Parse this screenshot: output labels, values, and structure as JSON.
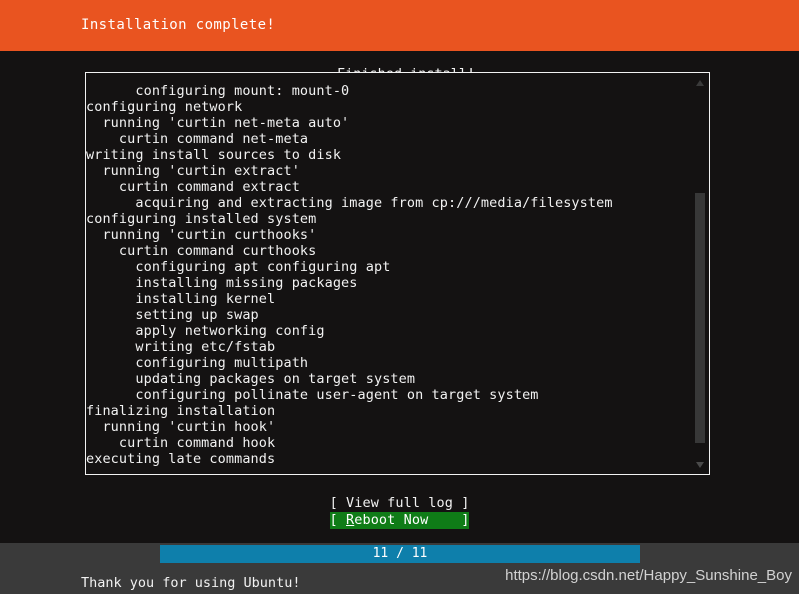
{
  "header": {
    "title": "Installation complete!",
    "background_color": "#e95420",
    "text_color": "#ffffff"
  },
  "log_panel": {
    "legend": "Finished install!",
    "border_color": "#f2f2f2",
    "lines": [
      "      configuring mount: mount-0",
      "configuring network",
      "  running 'curtin net-meta auto'",
      "    curtin command net-meta",
      "writing install sources to disk",
      "  running 'curtin extract'",
      "    curtin command extract",
      "      acquiring and extracting image from cp:///media/filesystem",
      "configuring installed system",
      "  running 'curtin curthooks'",
      "    curtin command curthooks",
      "      configuring apt configuring apt",
      "      installing missing packages",
      "      installing kernel",
      "      setting up swap",
      "      apply networking config",
      "      writing etc/fstab",
      "      configuring multipath",
      "      updating packages on target system",
      "      configuring pollinate user-agent on target system",
      "finalizing installation",
      "  running 'curtin hook'",
      "    curtin command hook",
      "executing late commands"
    ],
    "scrollbar": {
      "up_arrow": "scroll-up-arrow-icon",
      "down_arrow": "scroll-down-arrow-icon",
      "thumb_color": "#383838"
    }
  },
  "actions": {
    "view_full_log": "[ View full log ]",
    "reboot_now_prefix": "[ ",
    "reboot_now_accel": "R",
    "reboot_now_rest": "eboot Now    ]",
    "selected_color": "#0f7c17"
  },
  "progress": {
    "label": "11 / 11",
    "current": 11,
    "total": 11,
    "percent": 100,
    "fill_color": "#0e7fab"
  },
  "footer": {
    "thanks": "Thank you for using Ubuntu!",
    "watermark": "https://blog.csdn.net/Happy_Sunshine_Boy",
    "background_color": "#3a3a3a"
  }
}
